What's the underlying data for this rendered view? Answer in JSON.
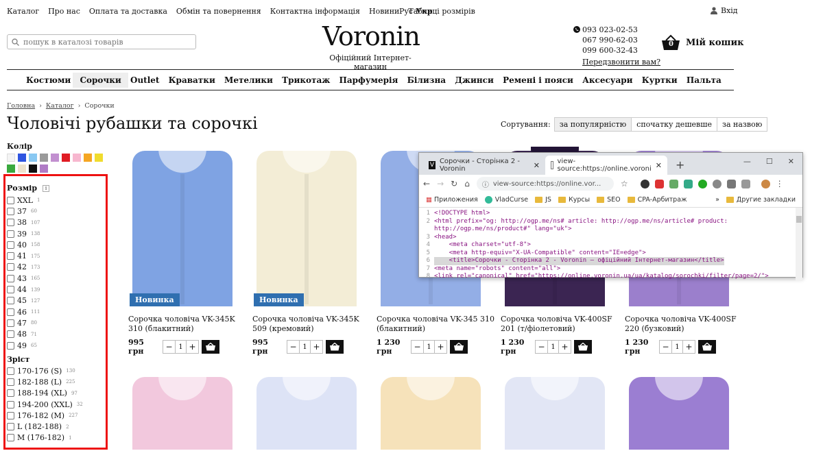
{
  "top_nav": [
    "Каталог",
    "Про нас",
    "Оплата та доставка",
    "Обмін та повернення",
    "Контактна інформація",
    "Новини",
    "Таблиці розмірів"
  ],
  "lang": {
    "ru": "Рус",
    "uk": "Укр"
  },
  "login_label": "Вхід",
  "search_placeholder": "пошук в каталозі товарів",
  "logo": {
    "word": "Voronin",
    "tagline": "Офіційний Інтернет-магазин"
  },
  "phones": [
    "093 023-02-53",
    "067 990-62-03",
    "099 600-32-43"
  ],
  "recall": "Передзвонити вам?",
  "cart": {
    "count": "0",
    "label": "Мій кошик"
  },
  "categories": [
    "Костюми",
    "Сорочки",
    "Outlet",
    "Краватки",
    "Метелики",
    "Трикотаж",
    "Парфумерія",
    "Білизна",
    "Джинси",
    "Ремені і пояси",
    "Аксесуари",
    "Куртки",
    "Пальта"
  ],
  "active_category": "Сорочки",
  "breadcrumbs": [
    "Головна",
    "Каталог",
    "Сорочки"
  ],
  "page_title": "Чоловічі рубашки та сорочкі",
  "sort": {
    "label": "Сортування:",
    "options": [
      "за популярністю",
      "спочатку дешевше",
      "за назвою"
    ],
    "active": "за популярністю"
  },
  "color_filter": {
    "label": "Колір",
    "swatches": [
      "#f4f4f4",
      "#2f55e0",
      "#89c8f2",
      "#9a9a9a",
      "#c290d0",
      "#e01c24",
      "#f7b7cf",
      "#f5a623",
      "#f0dc2e",
      "#3aa93e",
      "#eee3cd",
      "#111111",
      "#b07cc6"
    ]
  },
  "size_filter": {
    "label": "Розмір",
    "items": [
      {
        "v": "XXL",
        "c": "1"
      },
      {
        "v": "37",
        "c": "60"
      },
      {
        "v": "38",
        "c": "107"
      },
      {
        "v": "39",
        "c": "138"
      },
      {
        "v": "40",
        "c": "158"
      },
      {
        "v": "41",
        "c": "175"
      },
      {
        "v": "42",
        "c": "173"
      },
      {
        "v": "43",
        "c": "165"
      },
      {
        "v": "44",
        "c": "139"
      },
      {
        "v": "45",
        "c": "127"
      },
      {
        "v": "46",
        "c": "111"
      },
      {
        "v": "47",
        "c": "80"
      },
      {
        "v": "48",
        "c": "71"
      },
      {
        "v": "49",
        "c": "65"
      }
    ]
  },
  "height_filter": {
    "label": "Зріст",
    "items": [
      {
        "v": "170-176 (S)",
        "c": "130"
      },
      {
        "v": "182-188 (L)",
        "c": "225"
      },
      {
        "v": "188-194 (XL)",
        "c": "97"
      },
      {
        "v": "194-200 (XXL)",
        "c": "32"
      },
      {
        "v": "176-182 (M)",
        "c": "227"
      },
      {
        "v": "L (182-188)",
        "c": "2"
      },
      {
        "v": "M (176-182)",
        "c": "1"
      }
    ]
  },
  "products": [
    {
      "name": "Сорочка чоловіча VK-345K 310 (блакитний)",
      "price": "995 грн",
      "badge": "Новинка",
      "color": "#7fa3e3",
      "qty": "1"
    },
    {
      "name": "Сорочка чоловіча VK-345K 509 (кремовий)",
      "price": "995 грн",
      "badge": "Новинка",
      "color": "#f3edd6",
      "qty": "1"
    },
    {
      "name": "Сорочка чоловіча VK-345 310 (блакитний)",
      "price": "1 230 грн",
      "badge": "",
      "color": "#93aee6",
      "qty": "1"
    },
    {
      "name": "Сорочка чоловіча VK-400SF 201 (т/фіолетовий)",
      "price": "1 230 грн",
      "badge": "",
      "color": "#3b2552",
      "qty": "1"
    },
    {
      "name": "Сорочка чоловіча VK-400SF 220 (бузковий)",
      "price": "1 230 грн",
      "badge": "",
      "color": "#9b7fcc",
      "qty": "1"
    }
  ],
  "products_row2_colors": [
    "#f2c8dd",
    "#dde3f6",
    "#f6e2ba",
    "#e2e6f5",
    "#9b7ed2"
  ],
  "browser": {
    "tabs": [
      {
        "title": "Сорочки - Сторінка 2 - Voronin"
      },
      {
        "title": "view-source:https://online.voroni"
      }
    ],
    "url": "view-source:https://online.vor...",
    "bookmarks": [
      "Приложения",
      "VladCurse",
      "JS",
      "Курсы",
      "SEO",
      "CPA-Арбитраж"
    ],
    "other_bookmarks": "Другие закладки",
    "more": "»",
    "source_lines": [
      {
        "n": "1",
        "t": "<!DOCTYPE html>"
      },
      {
        "n": "2",
        "t": "<html prefix=\"og: http://ogp.me/ns# article: http://ogp.me/ns/article# product:"
      },
      {
        "n": "",
        "t": "http://ogp.me/ns/product#\" lang=\"uk\">"
      },
      {
        "n": "3",
        "t": "<head>"
      },
      {
        "n": "4",
        "t": "    <meta charset=\"utf-8\">"
      },
      {
        "n": "5",
        "t": "    <meta http-equiv=\"X-UA-Compatible\" content=\"IE=edge\">"
      },
      {
        "n": "6",
        "t": "    <title>Сорочки - Сторінка 2 - Voronin — офіційний Інтернет-магазин</title>"
      },
      {
        "n": "7",
        "t": "<meta name=\"robots\" content=\"all\">"
      },
      {
        "n": "8",
        "t": "<link rel=\"canonical\" href=\"https://online.voronin.ua/ua/katalog/sorochki/filter/page=2/\">"
      }
    ]
  }
}
